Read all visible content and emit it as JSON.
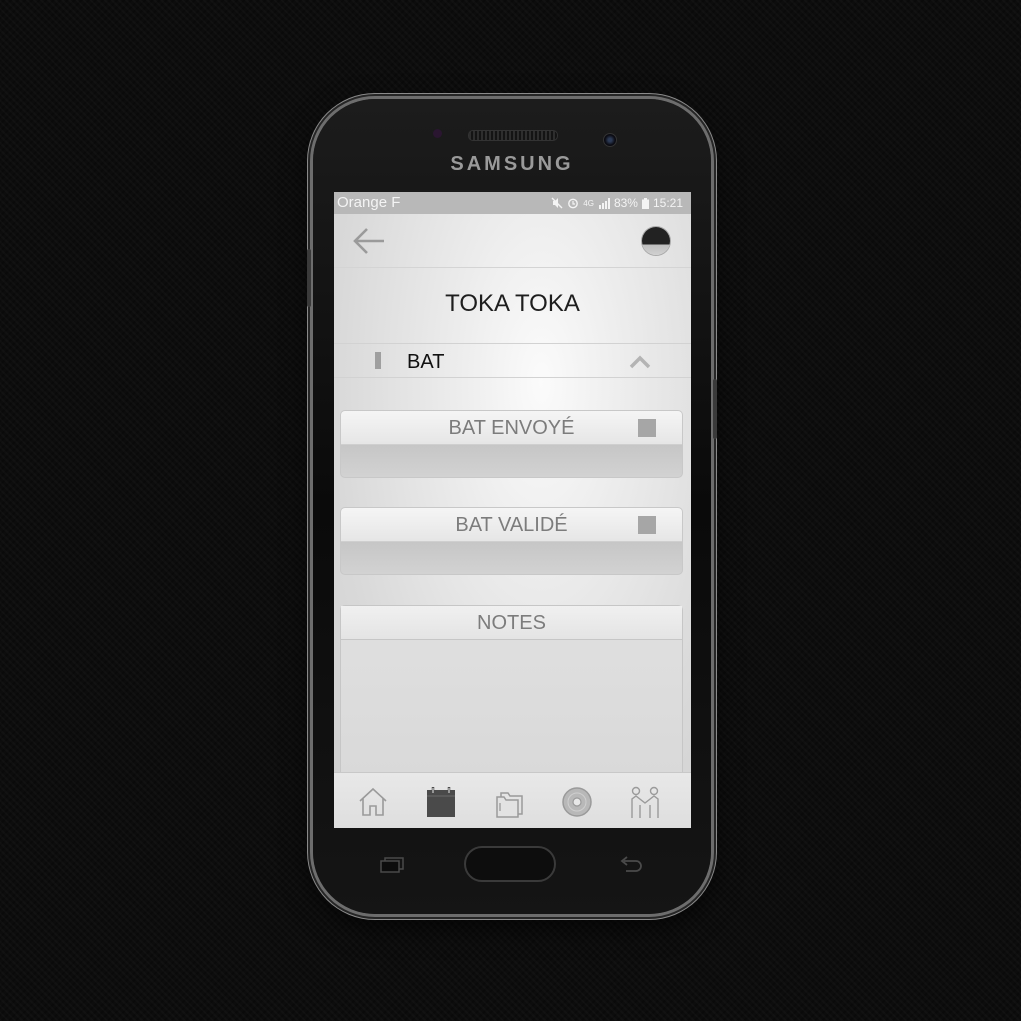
{
  "device": {
    "brand": "SAMSUNG"
  },
  "status_bar": {
    "carrier": "Orange F",
    "network": "4G",
    "battery": "83%",
    "time": "15:21"
  },
  "header": {
    "title": "TOKA TOKA"
  },
  "section": {
    "label": "BAT"
  },
  "cards": [
    {
      "label": "BAT ENVOYÉ",
      "checked": false
    },
    {
      "label": "BAT VALIDÉ",
      "checked": false
    }
  ],
  "notes": {
    "label": "NOTES",
    "value": ""
  },
  "tabs": [
    {
      "icon": "home-icon",
      "active": false
    },
    {
      "icon": "calendar-icon",
      "active": true
    },
    {
      "icon": "folders-icon",
      "active": false
    },
    {
      "icon": "disc-icon",
      "active": false
    },
    {
      "icon": "handshake-icon",
      "active": false
    }
  ],
  "colors": {
    "active_tab": "#4a4a4a",
    "inactive_tab": "#9a9a9a",
    "status_bar": "#b8b8b8"
  }
}
